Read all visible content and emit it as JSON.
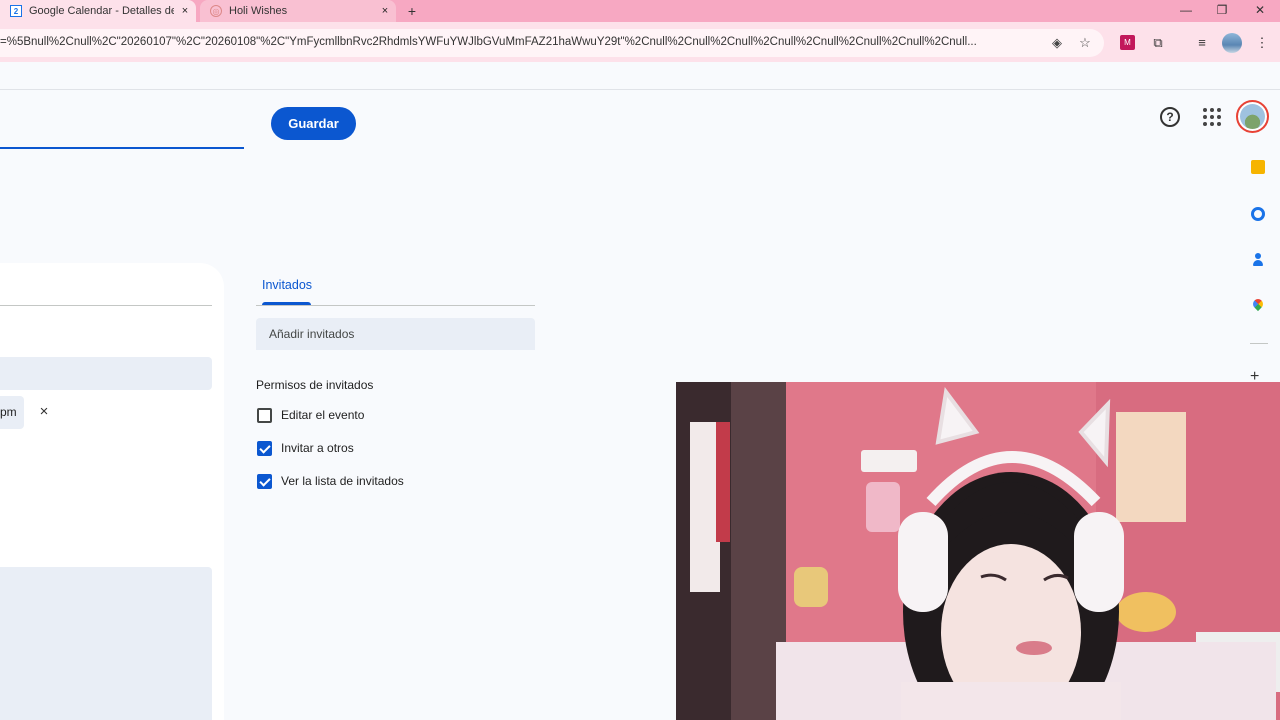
{
  "browser": {
    "tabs": [
      {
        "title": "Google Calendar - Detalles del",
        "favicon": "calendar-icon",
        "active": true
      },
      {
        "title": "Holi Wishes",
        "favicon": "globe-icon",
        "active": false
      }
    ],
    "favicon_calendar_text": "2",
    "new_tab_symbol": "+",
    "tab_close_symbol": "×",
    "window_controls": {
      "minimize": "—",
      "restore": "❐",
      "close": "✕"
    },
    "url": "=%5Bnull%2Cnull%2C\"20260107\"%2C\"20260108\"%2C\"YmFycmllbnRvc2RhdmlsYWFuYWJlbGVuMmFAZ21haWwuY29t\"%2Cnull%2Cnull%2Cnull%2Cnull%2Cnull%2Cnull%2Cnull%2Cnull...",
    "toolbar_icons": [
      "eye-icon",
      "star-icon",
      "extension-m-icon",
      "puzzle-icon",
      "media-control-icon",
      "profile-icon",
      "kebab-menu-icon"
    ]
  },
  "header": {
    "save_label": "Guardar",
    "help_symbol": "?"
  },
  "side_panel": {
    "icons": [
      "keep-icon",
      "tasks-icon",
      "contacts-icon",
      "maps-icon"
    ],
    "add_symbol": "+"
  },
  "form": {
    "time_chip_text": "pm",
    "chip_close_symbol": "×"
  },
  "guests": {
    "tab_label": "Invitados",
    "add_placeholder": "Añadir invitados",
    "permissions_title": "Permisos de invitados",
    "permissions": [
      {
        "label": "Editar el evento",
        "checked": false
      },
      {
        "label": "Invitar a otros",
        "checked": true
      },
      {
        "label": "Ver la lista de invitados",
        "checked": true
      }
    ]
  },
  "colors": {
    "accent": "#0b57d0",
    "tab_strip": "#f7a8c2",
    "toolbar": "#fde1ea",
    "page_bg": "#f8fafd",
    "field_bg": "#e9eef6"
  }
}
